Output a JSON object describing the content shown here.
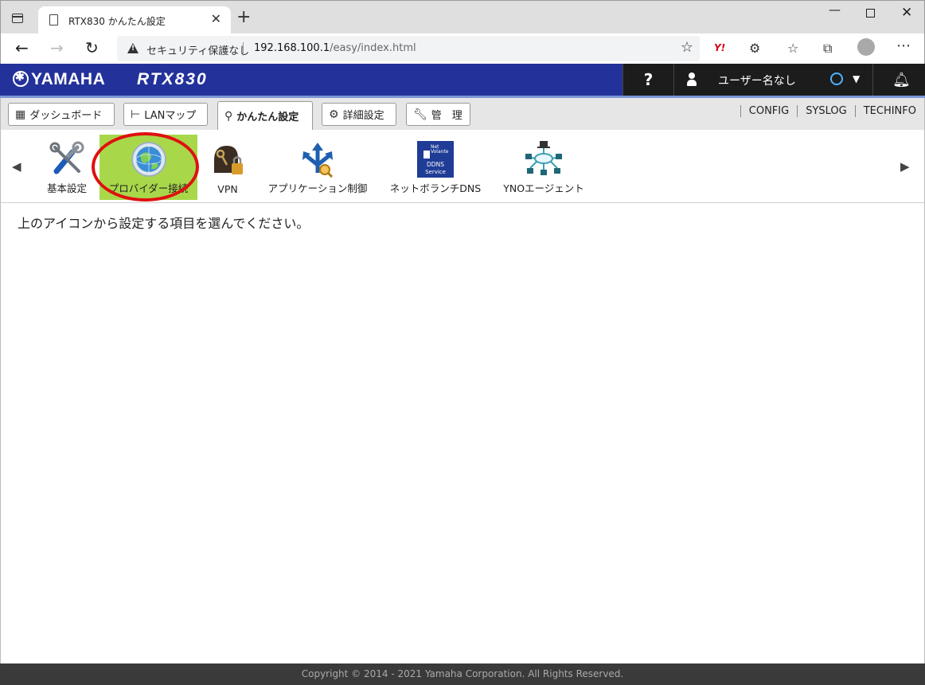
{
  "browser": {
    "tab_title": "RTX830 かんたん設定",
    "security_text": "セキュリティ保護なし",
    "url_host": "192.168.100.1",
    "url_path": "/easy/index.html"
  },
  "header": {
    "brand": "YAMAHA",
    "model": "RTX830",
    "help_label": "?",
    "user_name": "ユーザー名なし"
  },
  "tabs": {
    "dashboard": "ダッシュボード",
    "lan_map": "LANマップ",
    "easy_setup": "かんたん設定",
    "detail_setup": "詳細設定",
    "admin": "管　理"
  },
  "right_links": [
    "CONFIG",
    "SYSLOG",
    "TECHINFO"
  ],
  "strip": {
    "items": [
      {
        "label": "基本設定",
        "icon": "tools-icon"
      },
      {
        "label": "プロバイダー接続",
        "icon": "globe-icon"
      },
      {
        "label": "VPN",
        "icon": "keys-lock-icon"
      },
      {
        "label": "アプリケーション制御",
        "icon": "arrows-icon"
      },
      {
        "label": "ネットボランチDNS",
        "icon": "ddns-icon"
      },
      {
        "label": "YNOエージェント",
        "icon": "network-icon"
      }
    ],
    "ddns_badge_line1": "Net",
    "ddns_badge_line2": "Volante",
    "ddns_badge_line3": "DDNS",
    "ddns_badge_line4": "Service"
  },
  "content": {
    "instruction": "上のアイコンから設定する項目を選んでください。"
  },
  "footer": {
    "copyright": "Copyright © 2014 - 2021 Yamaha Corporation. All Rights Reserved."
  },
  "colors": {
    "header_bg": "#23329a",
    "selected_item_bg": "#a8d84a",
    "highlight_ring": "#e01010"
  }
}
